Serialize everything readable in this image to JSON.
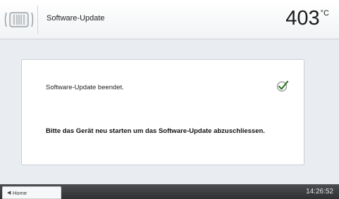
{
  "header": {
    "icon": "furnace-chamber-icon",
    "title": "Software-Update",
    "temperature": {
      "value": "403",
      "unit": "°C"
    }
  },
  "dialog": {
    "status_text": "Software-Update beendet.",
    "status_icon": "checkmark-icon",
    "instruction_text": "Bitte das Gerät neu starten um das Software-Update abzuschliessen."
  },
  "footer": {
    "home_label": "Home",
    "home_icon": "triangle-left-icon",
    "time": "14:26:52"
  },
  "colors": {
    "check_accent": "#3a7a2a",
    "footer_bg": "#3a3c40"
  }
}
